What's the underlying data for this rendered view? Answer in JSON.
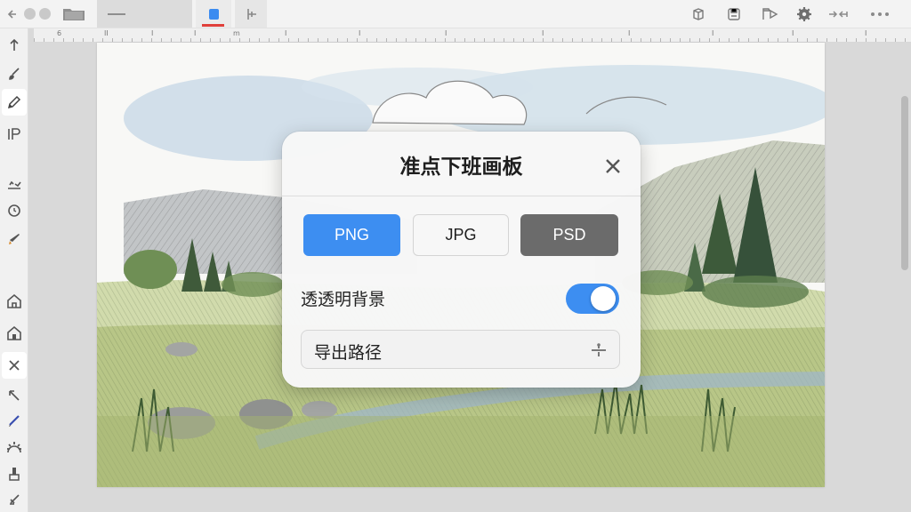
{
  "toolbar": {
    "tabs": [
      "tab-1",
      "tab-2"
    ],
    "left_icons": [
      "back-icon",
      "folder-icon"
    ],
    "tool_icons": [
      "color-square-icon",
      "ruler-guide-icon"
    ],
    "right_icons": [
      "layers-icon",
      "save-icon",
      "flag-play-icon",
      "settings-gear-icon",
      "transform-arrows-icon",
      "more-icon"
    ]
  },
  "ruler": {
    "labels": [
      "6",
      "II",
      "m",
      "I",
      "I",
      "I",
      "I",
      "I",
      "I",
      "I",
      "I",
      "I",
      "I"
    ]
  },
  "left_tools": [
    "move-icon",
    "brush-icon",
    "pencil-icon",
    "text-tool-icon",
    "baseline-icon",
    "circle-tool-icon",
    "marker-icon",
    "home-outline-icon",
    "home-icon",
    "close-icon",
    "arrow-icon",
    "pen-icon",
    "gear-icon",
    "stamp-icon",
    "eraser-icon"
  ],
  "dialog": {
    "title": "准点下班画板",
    "formats": {
      "png": "PNG",
      "jpg": "JPG",
      "psd": "PSD",
      "selected": "PNG"
    },
    "transparent_bg": {
      "label": "透透明背景",
      "enabled": true
    },
    "export_path": {
      "label": "导出路径"
    }
  },
  "colors": {
    "accent": "#3d8ef1",
    "psd_button": "#6b6b6b",
    "active_tab_underline": "#e0403b"
  }
}
